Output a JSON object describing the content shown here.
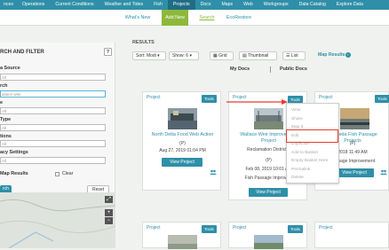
{
  "topnav": [
    "nces",
    "Operations",
    "Current Conditions",
    "Weather and Tides",
    "Fish",
    "Projects",
    "Docs",
    "Maps",
    "Web",
    "Workgroups",
    "Data Catalog",
    "Explore Data"
  ],
  "subnav": {
    "whats_new": "What's New",
    "add_new": "Add New",
    "search": "Search",
    "ecorestore": "EcoRestore"
  },
  "sidebar": {
    "title": "RCH AND FILTER",
    "help": "?",
    "source_label": "a Source",
    "search_label": "rch",
    "search_placeholder": "allace weir",
    "l3": "e",
    "l4": "Type",
    "l5": "tions",
    "l6": "acy Settings",
    "all": "All",
    "map_results": "Map Results",
    "clear": "Clear",
    "search_button": "rch",
    "reset_button": "Reset",
    "zoom_in": "+",
    "zoom_out": "−"
  },
  "results": {
    "section_title": "RESULTS",
    "sort": "Sort: Modi",
    "show": "Show: 6",
    "grid": "Grid",
    "thumbnail": "Thumbnail",
    "list": "List",
    "map_results": "Map Results",
    "info": "i",
    "tab_my_docs": "My Docs",
    "tab_public_docs": "Public Docs"
  },
  "cards": [
    {
      "label": "Project",
      "tools": "Tools",
      "name": "North Delta Food Web Action",
      "line1": "(P)",
      "line2": "Aug 27, 2019 01:04 PM",
      "view": "View Project"
    },
    {
      "label": "Project",
      "tools": "Tools",
      "name": "Wallace Weir Improvement Project",
      "line1": "Reclamation District 1",
      "line2": "(P)",
      "line3": "Feb 08, 2019 10:01 AM",
      "line4": "Fish Passage Improvem",
      "view": "View Project"
    },
    {
      "label": "Project",
      "tools": "Tools",
      "name": "Alameda Fish Passage Projects",
      "line1": "(P)",
      "line2": "2018 11:49 AM",
      "line3": "Passage Improvement",
      "view": "View Project"
    },
    {
      "label": "Project",
      "tools": "Tools"
    },
    {
      "label": "Project",
      "tools": "Tools"
    },
    {
      "label": "Project"
    }
  ],
  "tools_menu": [
    "View",
    "Share",
    "Map It",
    "Edit",
    "Duplicate",
    "Add to Basket",
    "Empty Basket Here",
    "Permalink",
    "Delete"
  ],
  "colors": {
    "nav": "#2f8fa8",
    "accent": "#8db83b",
    "highlight": "#e63a2e"
  }
}
